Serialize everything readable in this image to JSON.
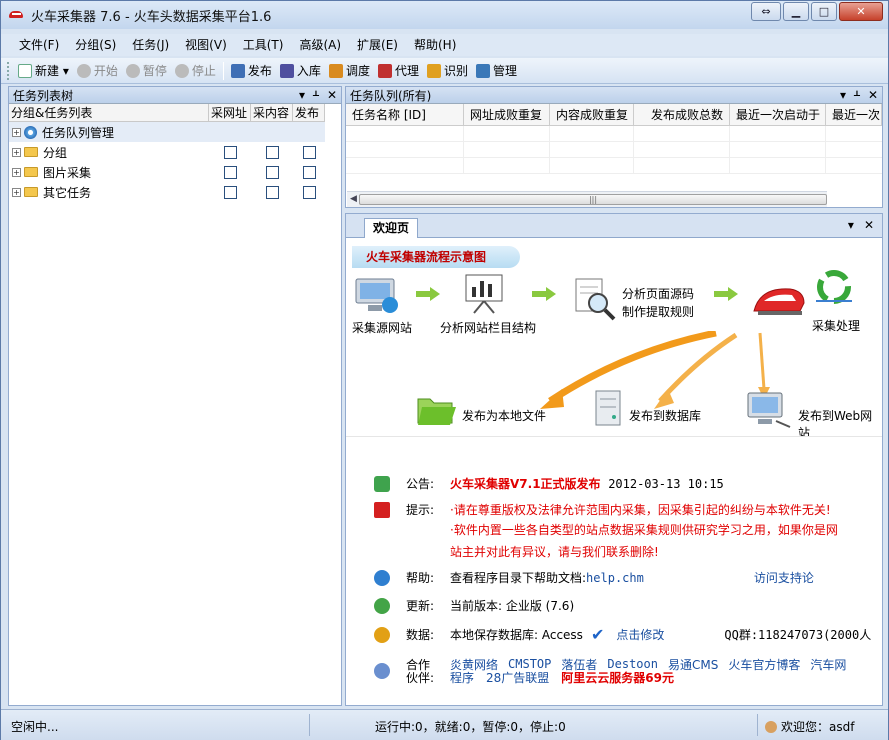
{
  "window": {
    "title": "火车采集器 7.6 - 火车头数据采集平台1.6"
  },
  "menu": [
    "文件(F)",
    "分组(S)",
    "任务(J)",
    "视图(V)",
    "工具(T)",
    "高级(A)",
    "扩展(E)",
    "帮助(H)"
  ],
  "toolbar": [
    {
      "label": "新建",
      "icon": "new-icon",
      "enabled": true
    },
    {
      "label": "开始",
      "icon": "play-icon",
      "enabled": false
    },
    {
      "label": "暂停",
      "icon": "pause-icon",
      "enabled": false
    },
    {
      "label": "停止",
      "icon": "stop-icon",
      "enabled": false
    },
    {
      "label": "发布",
      "icon": "publish-icon",
      "enabled": true
    },
    {
      "label": "入库",
      "icon": "import-icon",
      "enabled": true
    },
    {
      "label": "调度",
      "icon": "schedule-icon",
      "enabled": true
    },
    {
      "label": "代理",
      "icon": "proxy-icon",
      "enabled": true
    },
    {
      "label": "识别",
      "icon": "recognize-icon",
      "enabled": true
    },
    {
      "label": "管理",
      "icon": "manage-icon",
      "enabled": true
    }
  ],
  "task_tree": {
    "title": "任务列表树",
    "columns": [
      "分组&任务列表",
      "采网址",
      "采内容",
      "发布"
    ],
    "rows": [
      {
        "label": "任务队列管理",
        "has_checks": false
      },
      {
        "label": "分组",
        "has_checks": true
      },
      {
        "label": "图片采集",
        "has_checks": true
      },
      {
        "label": "其它任务",
        "has_checks": true
      }
    ]
  },
  "queue": {
    "title": "任务队列(所有)",
    "columns": [
      "任务名称 [ID]",
      "网址成败重复",
      "内容成败重复",
      "发布成败总数",
      "最近一次启动于",
      "最近一次"
    ]
  },
  "welcome": {
    "tab": "欢迎页",
    "banner": "火车采集器流程示意图",
    "steps": {
      "source": "采集源网站",
      "analyze": "分析网站栏目结构",
      "rule1": "分析页面源码",
      "rule2": "制作提取规则",
      "process": "采集处理"
    },
    "outputs": {
      "local": "发布为本地文件",
      "db": "发布到数据库",
      "web": "发布到Web网站"
    }
  },
  "info": {
    "notice_label": "公告:",
    "notice_text": "火车采集器V7.1正式版发布",
    "notice_date": "2012-03-13 10:15",
    "tip_label": "提示:",
    "tip1": "·请在尊重版权及法律允许范围内采集，因采集引起的纠纷与本软件无关!",
    "tip2": "·软件内置一些各自类型的站点数据采集规则供研究学习之用，如果你是网",
    "tip3": "站主并对此有异议，请与我们联系删除!",
    "help_label": "帮助:",
    "help_text": "查看程序目录下帮助文档:",
    "help_file": "help.chm",
    "help_link": "访问支持论",
    "update_label": "更新:",
    "update_text": "当前版本: 企业版  (7.6)",
    "data_label": "数据:",
    "data_text": "本地保存数据库: Access",
    "data_link": "点击修改",
    "qq": "QQ群:118247073(2000人",
    "partner_label1": "合作",
    "partner_label2": "伙伴:",
    "partners_row1": [
      "炎黄网络",
      "CMSTOP",
      "落伍者",
      "Destoon",
      "易通CMS",
      "火车官方博客",
      "汽车网"
    ],
    "partners_row2": [
      "程序",
      "28广告联盟"
    ],
    "partner_red": "阿里云云服务器69元"
  },
  "status": {
    "idle": "空闲中...",
    "counts": "运行中:0，就绪:0，暂停:0，停止:0",
    "welcome": "欢迎您：asdf"
  }
}
